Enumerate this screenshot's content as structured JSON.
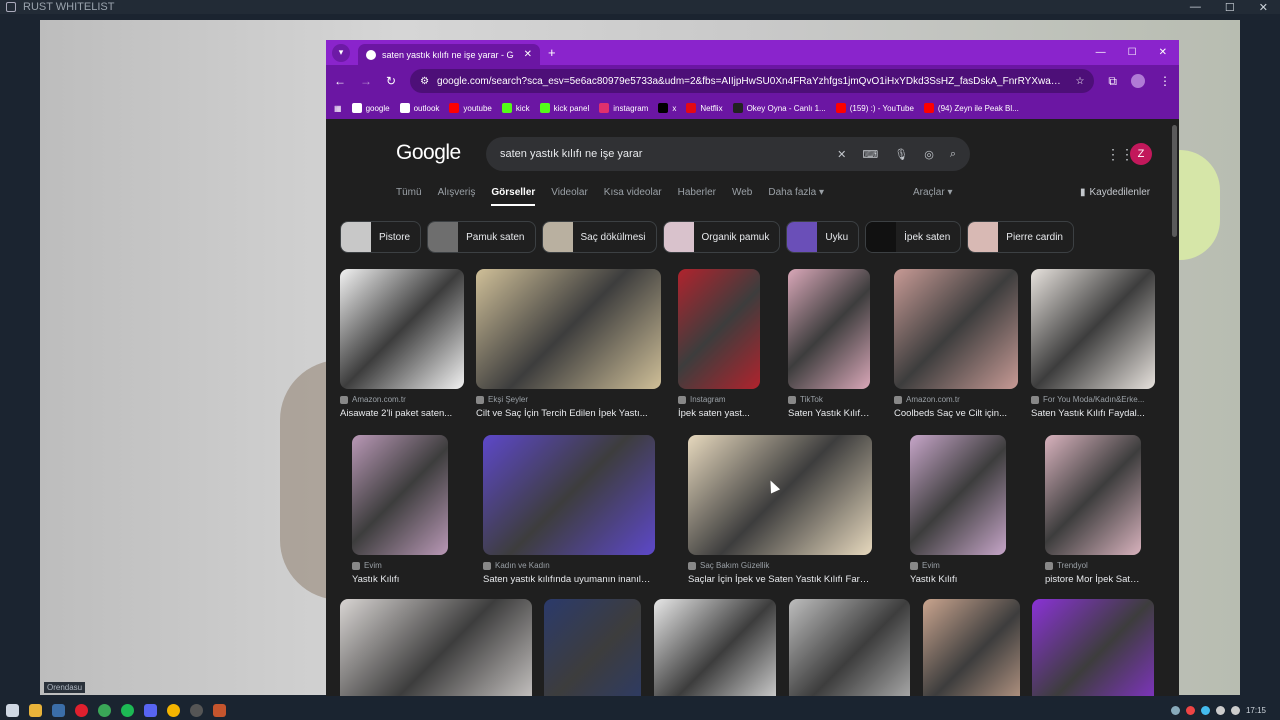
{
  "outer_window": {
    "title": "RUST WHITELIST",
    "min": "—",
    "max": "☐",
    "close": "✕"
  },
  "overlay_label": "Orendasu",
  "browser": {
    "tab_title": "saten yastık kılıfı ne işe yarar - Google",
    "tab_close": "✕",
    "new_tab": "+",
    "win_min": "—",
    "win_max": "☐",
    "win_close": "✕",
    "url": "google.com/search?sca_esv=5e6ac80979e5733a&udm=2&fbs=AIIjpHwSU0Xn4FRaYzhfgs1jmQvO1iHxYDkd3SsHZ_fasDskA_FnrRYXwaoTYk_bFZyqo4J...",
    "bookmarks": [
      {
        "label": "google",
        "color": "#ffffff"
      },
      {
        "label": "outlook",
        "color": "#ffffff"
      },
      {
        "label": "youtube",
        "color": "#ff0000"
      },
      {
        "label": "kick",
        "color": "#53fc18"
      },
      {
        "label": "kick panel",
        "color": "#53fc18"
      },
      {
        "label": "instagram",
        "color": "#e1306c"
      },
      {
        "label": "x",
        "color": "#000000"
      },
      {
        "label": "Netflix",
        "color": "#e50914"
      },
      {
        "label": "Okey Oyna - Canlı 1...",
        "color": "#222222"
      },
      {
        "label": "(159) :) - YouTube",
        "color": "#ff0000"
      },
      {
        "label": "(94) Zeyn ile Peak Bl...",
        "color": "#ff0000"
      }
    ]
  },
  "google": {
    "logo": "Google",
    "query": "saten yastık kılıfı ne işe yarar",
    "profile_initial": "Z",
    "nav_tabs": [
      "Tümü",
      "Alışveriş",
      "Görseller",
      "Videolar",
      "Kısa videolar",
      "Haberler",
      "Web",
      "Daha fazla ▾"
    ],
    "tools": "Araçlar ▾",
    "saved": "Kaydedilenler",
    "chips": [
      {
        "label": "Pistore",
        "color": "#c8c8c8"
      },
      {
        "label": "Pamuk saten",
        "color": "#6e6e6e"
      },
      {
        "label": "Saç dökülmesi",
        "color": "#b9b0a0"
      },
      {
        "label": "Organik pamuk",
        "color": "#d9c2cc"
      },
      {
        "label": "Uyku",
        "color": "#6a4fb8"
      },
      {
        "label": "İpek saten",
        "color": "#111111"
      },
      {
        "label": "Pierre cardin",
        "color": "#d8b9b4"
      }
    ],
    "row1": [
      {
        "source": "Amazon.com.tr",
        "title": "Aisawate 2'li paket saten...",
        "color": "#f2f2f2"
      },
      {
        "source": "Ekşi Şeyler",
        "title": "Cilt ve Saç İçin Tercih Edilen İpek Yastı...",
        "color": "#cfbf98"
      },
      {
        "source": "Instagram",
        "title": "İpek saten yast...",
        "color": "#b0232d"
      },
      {
        "source": "TikTok",
        "title": "Saten Yastık Kılıfı ...",
        "color": "#d9a7b8"
      },
      {
        "source": "Amazon.com.tr",
        "title": "Coolbeds Saç ve Cilt için...",
        "color": "#c79a95"
      },
      {
        "source": "For You Moda/Kadın&Erke...",
        "title": "Saten Yastık Kılıfı Faydal...",
        "color": "#e7e2dd"
      }
    ],
    "row2": [
      {
        "source": "Evim",
        "title": "Yastık Kılıfı",
        "color": "#b998b6"
      },
      {
        "source": "Kadın ve Kadın",
        "title": "Saten yastık kılıfında uyumanın inanılm...",
        "color": "#5d48c9"
      },
      {
        "source": "Saç Bakım Güzellik",
        "title": "Saçlar İçin İpek ve Saten Yastık Kılıfı Farkı N...",
        "color": "#e6d8bd"
      },
      {
        "source": "Evim",
        "title": "Yastık Kılıfı",
        "color": "#c6a5c8"
      },
      {
        "source": "Trendyol",
        "title": "pistore Mor İpek Saten Y...",
        "color": "#d8b2bd"
      }
    ],
    "row3": [
      {
        "color": "#d8d4d2"
      },
      {
        "color": "#2b3a6b"
      },
      {
        "color": "#e7e7e7"
      },
      {
        "color": "#bdbdbd"
      },
      {
        "color": "#c9a48e"
      },
      {
        "color": "#8a32d6"
      }
    ]
  },
  "clock": "17:15"
}
